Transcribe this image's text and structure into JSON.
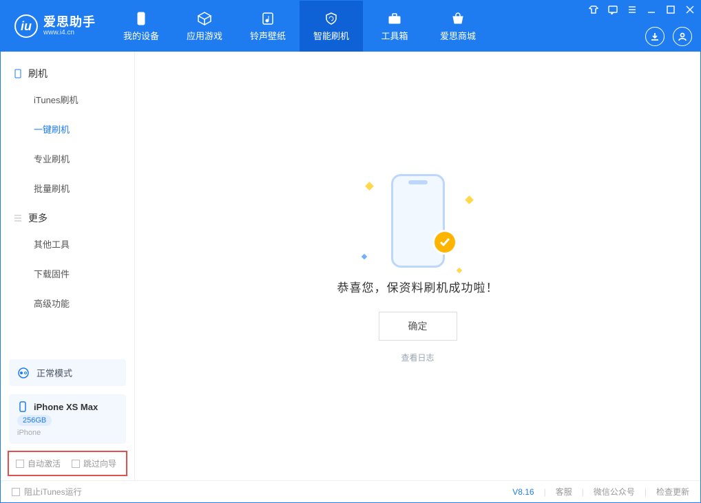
{
  "brand": {
    "title": "爱思助手",
    "subtitle": "www.i4.cn"
  },
  "nav": {
    "tab0": "我的设备",
    "tab1": "应用游戏",
    "tab2": "铃声壁纸",
    "tab3": "智能刷机",
    "tab4": "工具箱",
    "tab5": "爱思商城"
  },
  "sidebar": {
    "group_flash": "刷机",
    "item_itunes": "iTunes刷机",
    "item_oneclick": "一键刷机",
    "item_pro": "专业刷机",
    "item_batch": "批量刷机",
    "group_more": "更多",
    "item_other": "其他工具",
    "item_download": "下载固件",
    "item_advanced": "高级功能"
  },
  "status": {
    "mode": "正常模式"
  },
  "device": {
    "name": "iPhone XS Max",
    "storage": "256GB",
    "type": "iPhone"
  },
  "checks": {
    "auto_activate": "自动激活",
    "skip_guide": "跳过向导"
  },
  "main": {
    "message": "恭喜您，保资料刷机成功啦！",
    "confirm": "确定",
    "view_log": "查看日志"
  },
  "footer": {
    "block_itunes": "阻止iTunes运行",
    "version": "V8.16",
    "support": "客服",
    "wechat": "微信公众号",
    "check_update": "检查更新"
  }
}
